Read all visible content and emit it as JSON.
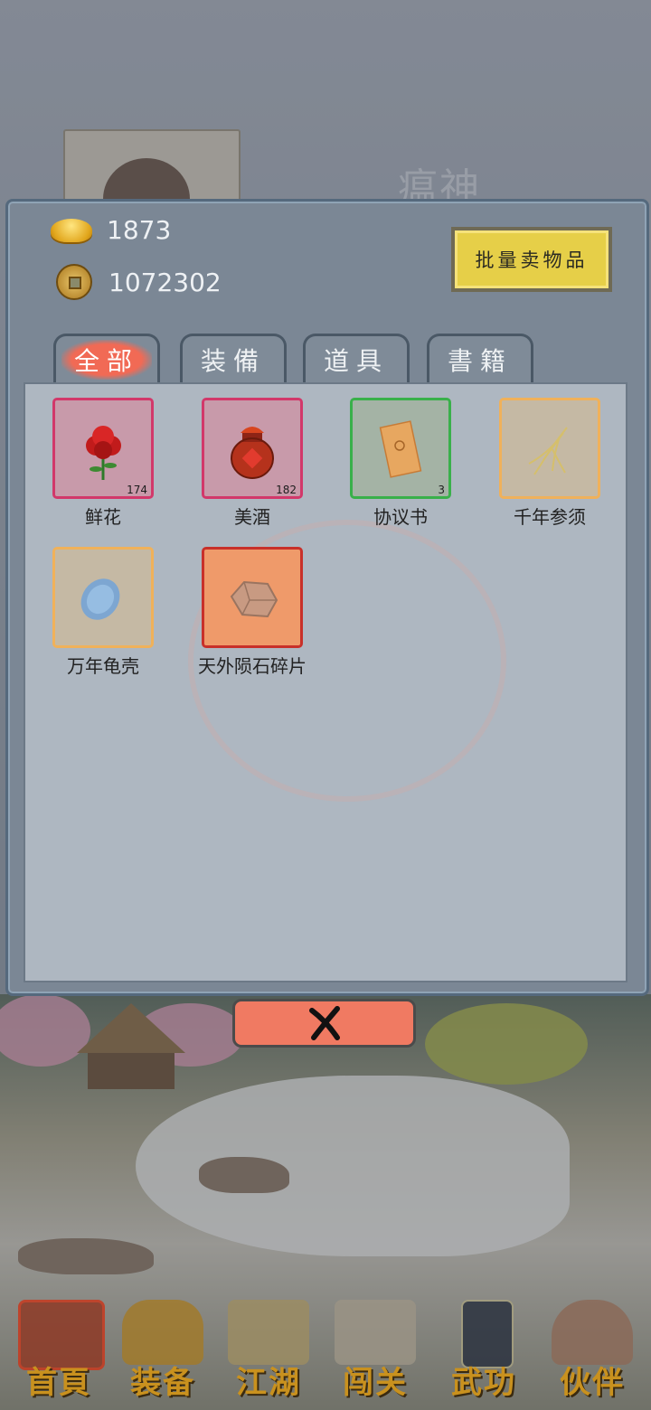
{
  "background": {
    "character_name": "瘟神"
  },
  "resources": {
    "gold": "1873",
    "copper": "1072302"
  },
  "sell_button": "批量卖物品",
  "tabs": [
    {
      "label": "全部",
      "active": true
    },
    {
      "label": "装備",
      "active": false
    },
    {
      "label": "道具",
      "active": false
    },
    {
      "label": "書籍",
      "active": false
    }
  ],
  "items": [
    {
      "name": "鲜花",
      "count": "174",
      "icon": "rose-icon",
      "rarity_color": "#d2386a",
      "slot_bg": "#c89aaa"
    },
    {
      "name": "美酒",
      "count": "182",
      "icon": "wine-jar-icon",
      "rarity_color": "#d2386a",
      "slot_bg": "#c89aaa"
    },
    {
      "name": "协议书",
      "count": "3",
      "icon": "scroll-icon",
      "rarity_color": "#39b04a",
      "slot_bg": "#a4b3a5"
    },
    {
      "name": "千年参须",
      "count": "",
      "icon": "ginseng-icon",
      "rarity_color": "#f0b15a",
      "slot_bg": "#c5b9a4"
    },
    {
      "name": "万年龟壳",
      "count": "",
      "icon": "turtle-shell-icon",
      "rarity_color": "#f0b15a",
      "slot_bg": "#c5b9a4"
    },
    {
      "name": "天外陨石碎片",
      "count": "",
      "icon": "meteorite-icon",
      "rarity_color": "#c8302a",
      "slot_bg": "#ef9a6a"
    }
  ],
  "close_button": "close-icon",
  "nav": [
    {
      "label": "首頁",
      "icon": "home-icon"
    },
    {
      "label": "装备",
      "icon": "armor-icon"
    },
    {
      "label": "江湖",
      "icon": "map-scroll-icon"
    },
    {
      "label": "闯关",
      "icon": "crossed-swords-icon"
    },
    {
      "label": "武功",
      "icon": "martial-book-icon"
    },
    {
      "label": "伙伴",
      "icon": "partners-icon"
    }
  ]
}
